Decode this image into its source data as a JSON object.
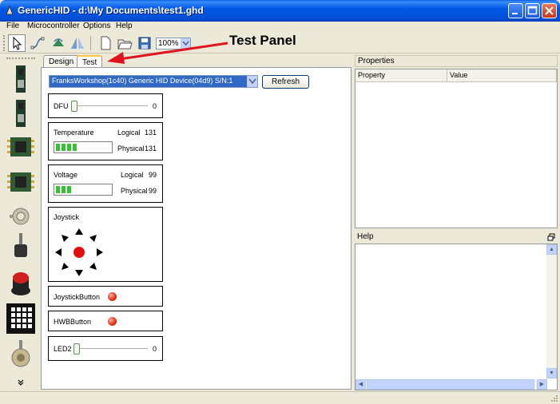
{
  "window": {
    "title": "GenericHID - d:\\My Documents\\test1.ghd"
  },
  "menu": [
    "File",
    "Microcontroller",
    "Options",
    "Help"
  ],
  "toolbar": {
    "zoom": "100%"
  },
  "tabs": [
    "Design",
    "Test"
  ],
  "annotation": "Test Panel",
  "test_panel": {
    "device": "FranksWorkshop(1c40) Generic HID Device(04d9)  S/N:1",
    "refresh_label": "Refresh",
    "dfu": {
      "label": "DFU",
      "value": "0",
      "level": 0
    },
    "temperature": {
      "label": "Temperature",
      "logical_label": "Logical",
      "logical_value": "131",
      "physical_label": "Physical",
      "physical_value": "131",
      "bar_segments": 4
    },
    "voltage": {
      "label": "Voltage",
      "logical_label": "Logical",
      "logical_value": "99",
      "physical_label": "Physical",
      "physical_value": "99",
      "bar_segments": 3
    },
    "joystick": {
      "label": "Joystick"
    },
    "joystick_button": {
      "label": "JoystickButton"
    },
    "hwb_button": {
      "label": "HWBButton"
    },
    "led2": {
      "label": "LED2",
      "value": "0",
      "level": 0
    }
  },
  "properties": {
    "title": "Properties",
    "columns": [
      "Property",
      "Value"
    ]
  },
  "help": {
    "title": "Help"
  },
  "colors": {
    "titlebar": "#0058e6",
    "led": "#e8331c",
    "progress": "#34c234",
    "selection": "#316ac5",
    "arrow": "#e0141e"
  }
}
